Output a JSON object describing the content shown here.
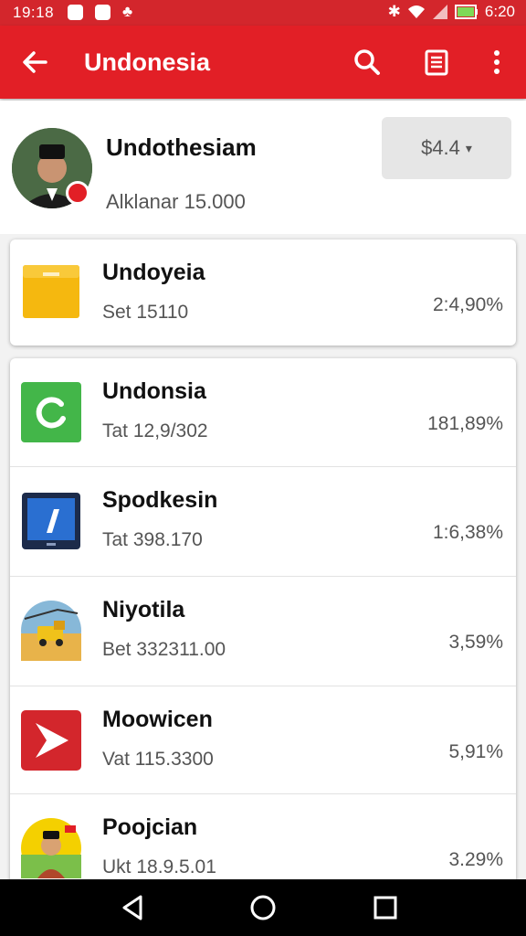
{
  "status_bar": {
    "time": "19:18",
    "right_time": "6:20"
  },
  "app_bar": {
    "title": "Undonesia"
  },
  "profile": {
    "name": "Undothesiam",
    "subtitle": "Alklanar 15.000",
    "price": "$4.4"
  },
  "featured": {
    "name": "Undoyeia",
    "subtitle": "Set 15110",
    "percent": "2:4,90%",
    "icon": "folder-icon",
    "icon_color": "#f5b80f"
  },
  "items": [
    {
      "name": "Undonsia",
      "subtitle": "Tat 12,9/302",
      "percent": "181,89%",
      "icon": "refresh-app-icon",
      "icon_color": "#43b649"
    },
    {
      "name": "Spodkesin",
      "subtitle": "Tat 398.170",
      "percent": "1:6,38%",
      "icon": "tablet-app-icon",
      "icon_color": "#2a6fd1"
    },
    {
      "name": "Niyotila",
      "subtitle": "Bet 332311.00",
      "percent": "3,59%",
      "icon": "truck-photo-icon",
      "icon_color": "#f0b13a"
    },
    {
      "name": "Moowicen",
      "subtitle": "Vat 115.3300",
      "percent": "5,91%",
      "icon": "play-arrow-icon",
      "icon_color": "#d3262c"
    },
    {
      "name": "Poojcian",
      "subtitle": "Ukt 18.9.5.01",
      "percent": "3.29%",
      "icon": "person-photo-icon",
      "icon_color": "#7bbf4a"
    }
  ],
  "colors": {
    "brand": "#e21f26",
    "status": "#d3262c",
    "background": "#f2f2f2"
  }
}
